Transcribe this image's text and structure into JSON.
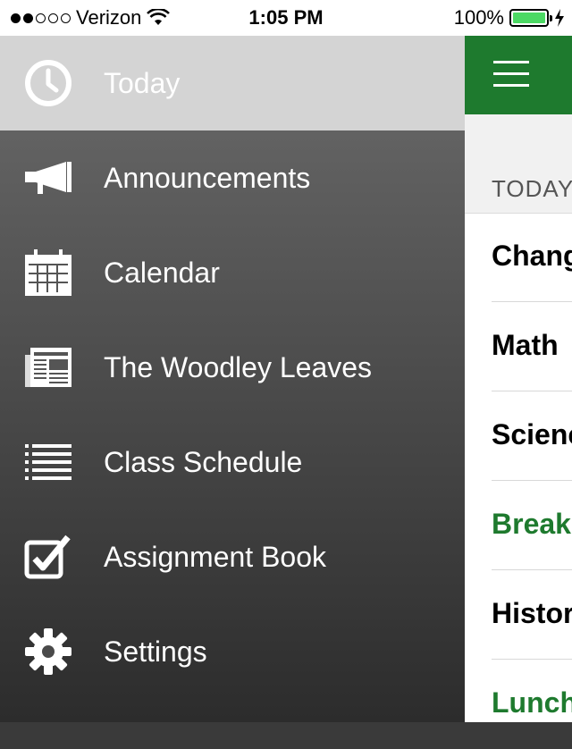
{
  "status_bar": {
    "carrier": "Verizon",
    "time": "1:05 PM",
    "battery": "100%",
    "signal_bars_filled": 2,
    "signal_bars_total": 5
  },
  "drawer": {
    "items": [
      {
        "label": "Today",
        "icon": "clock-icon",
        "active": true
      },
      {
        "label": "Announcements",
        "icon": "megaphone-icon"
      },
      {
        "label": "Calendar",
        "icon": "calendar-icon"
      },
      {
        "label": "The Woodley Leaves",
        "icon": "newspaper-icon"
      },
      {
        "label": "Class Schedule",
        "icon": "list-icon"
      },
      {
        "label": "Assignment Book",
        "icon": "checkbox-icon"
      },
      {
        "label": "Settings",
        "icon": "gear-icon"
      }
    ]
  },
  "main": {
    "section_title": "TODAY",
    "rows": [
      {
        "text": "Chang",
        "highlight": false
      },
      {
        "text": "Math",
        "highlight": false
      },
      {
        "text": "Scienc",
        "highlight": false
      },
      {
        "text": "Break",
        "highlight": true
      },
      {
        "text": "Histor",
        "highlight": false
      },
      {
        "text": "Lunch",
        "highlight": true
      }
    ]
  },
  "colors": {
    "accent_green": "#1e7a2e",
    "battery_green": "#4cd964",
    "active_item_bg": "#d4d4d4"
  }
}
